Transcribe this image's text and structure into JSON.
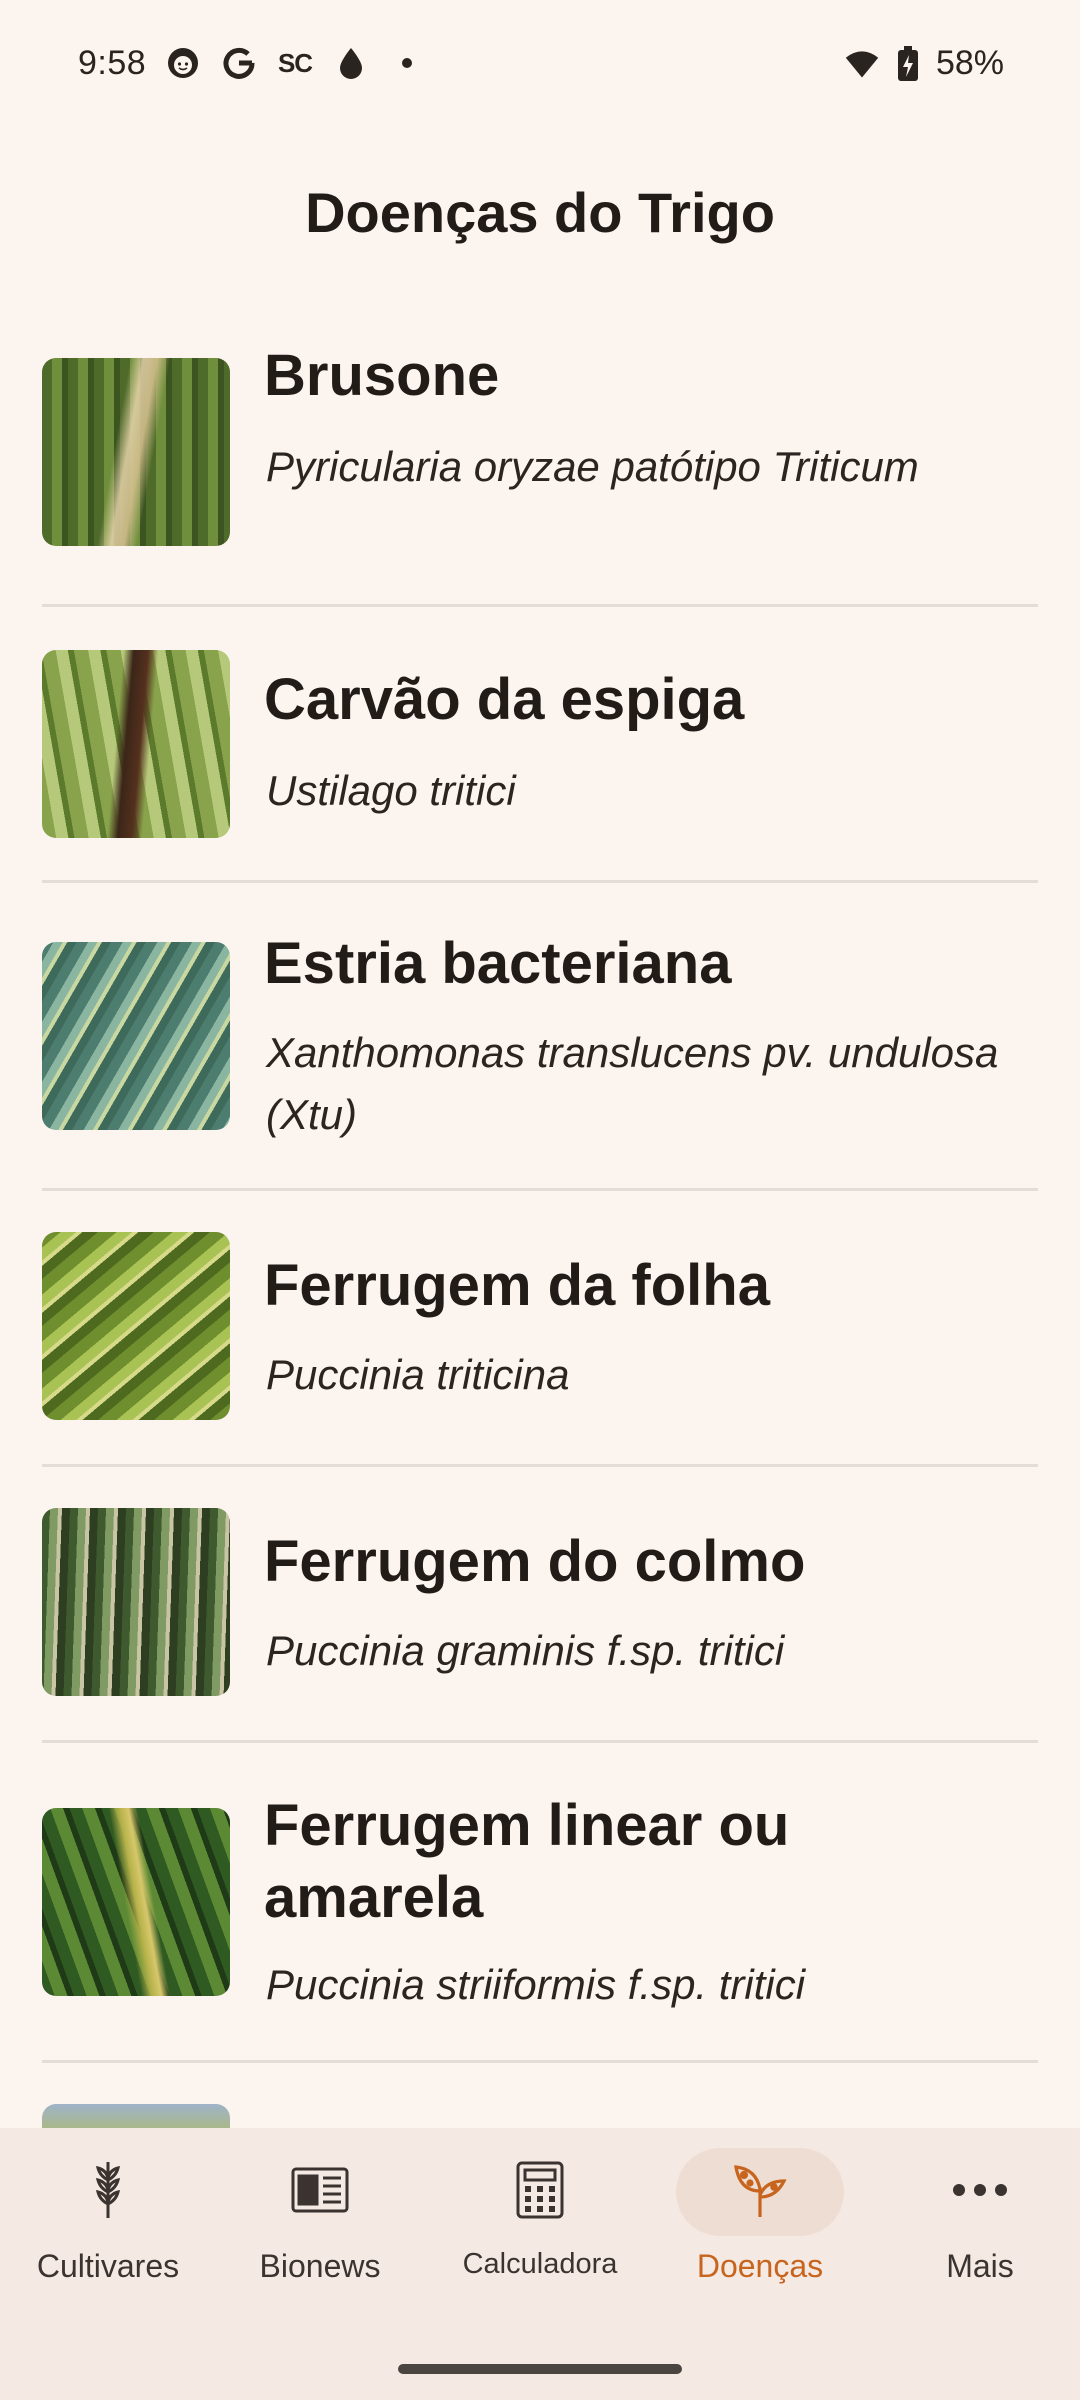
{
  "status_bar": {
    "time": "9:58",
    "left_icons": [
      "face-icon",
      "google-icon",
      "sc-icon",
      "drop-icon",
      "dot-icon"
    ],
    "sc_text": "SC",
    "battery": "58%",
    "right_icons": [
      "wifi-icon",
      "battery-charging-icon"
    ]
  },
  "page": {
    "title": "Doenças do Trigo"
  },
  "diseases": [
    {
      "name": "Brusone",
      "scientific": "Pyricularia oryzae patótipo Triticum"
    },
    {
      "name": "Carvão da espiga",
      "scientific": "Ustilago tritici"
    },
    {
      "name": "Estria bacteriana",
      "scientific": "Xanthomonas translucens pv. undulosa (Xtu)"
    },
    {
      "name": "Ferrugem da folha",
      "scientific": "Puccinia triticina"
    },
    {
      "name": "Ferrugem do colmo",
      "scientific": "Puccinia graminis f.sp. tritici"
    },
    {
      "name": "Ferrugem linear ou amarela",
      "scientific": "Puccinia striiformis f.sp. tritici"
    }
  ],
  "bottom_nav": {
    "items": [
      {
        "label": "Cultivares",
        "icon": "wheat-icon",
        "active": false
      },
      {
        "label": "Bionews",
        "icon": "news-icon",
        "active": false
      },
      {
        "label": "Calculadora",
        "icon": "calculator-icon",
        "active": false
      },
      {
        "label": "Doenças",
        "icon": "plant-disease-icon",
        "active": true
      },
      {
        "label": "Mais",
        "icon": "more-horizontal-icon",
        "active": false
      }
    ]
  },
  "colors": {
    "background": "#FBF4EF",
    "nav_background": "#F4E9E3",
    "accent": "#C7651F",
    "active_pill": "#EEDDD3",
    "divider": "#E4DCD6"
  }
}
